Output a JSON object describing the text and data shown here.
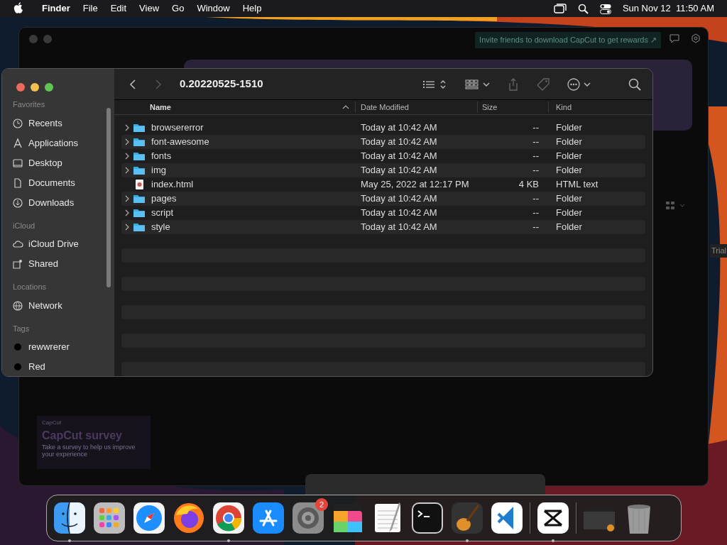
{
  "menubar": {
    "app": "Finder",
    "menus": [
      "File",
      "Edit",
      "View",
      "Go",
      "Window",
      "Help"
    ],
    "clock": "Sun Nov 12  11:50 AM"
  },
  "background_window": {
    "invite_banner": "Invite friends to download CapCut to get rewards ↗",
    "side_label": "Trial",
    "survey": {
      "brand": "CapCut",
      "title": "CapCut survey",
      "body": "Take a survey to help us improve your experience"
    }
  },
  "finder": {
    "title": "0.20220525-1510",
    "sidebar": [
      {
        "heading": "Favorites",
        "items": [
          {
            "label": "Recents",
            "kind": "clock"
          },
          {
            "label": "Applications",
            "kind": "apps"
          },
          {
            "label": "Desktop",
            "kind": "desktop"
          },
          {
            "label": "Documents",
            "kind": "doc"
          },
          {
            "label": "Downloads",
            "kind": "download"
          }
        ]
      },
      {
        "heading": "iCloud",
        "items": [
          {
            "label": "iCloud Drive",
            "kind": "cloud"
          },
          {
            "label": "Shared",
            "kind": "shared"
          }
        ]
      },
      {
        "heading": "Locations",
        "items": [
          {
            "label": "Network",
            "kind": "globe"
          }
        ]
      },
      {
        "heading": "Tags",
        "items": [
          {
            "label": "rewwrerer",
            "kind": "tag",
            "color": "#000000"
          },
          {
            "label": "Red",
            "kind": "tag",
            "color": "#000000"
          }
        ]
      }
    ],
    "columns": [
      {
        "label": "Name",
        "sorted": true
      },
      {
        "label": "Date Modified",
        "sorted": false
      },
      {
        "label": "Size",
        "sorted": false
      },
      {
        "label": "Kind",
        "sorted": false
      }
    ],
    "rows": [
      {
        "name": "browsererror",
        "date": "Today at 10:42 AM",
        "size": "--",
        "kind_text": "Folder",
        "kind": "folder"
      },
      {
        "name": "font-awesome",
        "date": "Today at 10:42 AM",
        "size": "--",
        "kind_text": "Folder",
        "kind": "folder"
      },
      {
        "name": "fonts",
        "date": "Today at 10:42 AM",
        "size": "--",
        "kind_text": "Folder",
        "kind": "folder"
      },
      {
        "name": "img",
        "date": "Today at 10:42 AM",
        "size": "--",
        "kind_text": "Folder",
        "kind": "folder"
      },
      {
        "name": "index.html",
        "date": "May 25, 2022 at 12:17 PM",
        "size": "4 KB",
        "kind_text": "HTML text",
        "kind": "file"
      },
      {
        "name": "pages",
        "date": "Today at 10:42 AM",
        "size": "--",
        "kind_text": "Folder",
        "kind": "folder"
      },
      {
        "name": "script",
        "date": "Today at 10:42 AM",
        "size": "--",
        "kind_text": "Folder",
        "kind": "folder"
      },
      {
        "name": "style",
        "date": "Today at 10:42 AM",
        "size": "--",
        "kind_text": "Folder",
        "kind": "folder"
      }
    ]
  },
  "dock": [
    {
      "kind": "finder",
      "running": true
    },
    {
      "kind": "launchpad",
      "running": false
    },
    {
      "kind": "safari",
      "running": false
    },
    {
      "kind": "firefox",
      "running": false
    },
    {
      "kind": "chrome",
      "running": true
    },
    {
      "kind": "appstore",
      "running": false
    },
    {
      "kind": "settings",
      "running": false,
      "badge": "2"
    },
    {
      "kind": "video",
      "running": false
    },
    {
      "kind": "notes",
      "running": false
    },
    {
      "kind": "terminal",
      "running": false
    },
    {
      "kind": "guitar",
      "running": true
    },
    {
      "kind": "vscode",
      "running": false
    },
    {
      "kind": "divider"
    },
    {
      "kind": "capcut",
      "running": true
    },
    {
      "kind": "divider"
    },
    {
      "kind": "folder",
      "running": false
    },
    {
      "kind": "trash",
      "running": false
    }
  ]
}
